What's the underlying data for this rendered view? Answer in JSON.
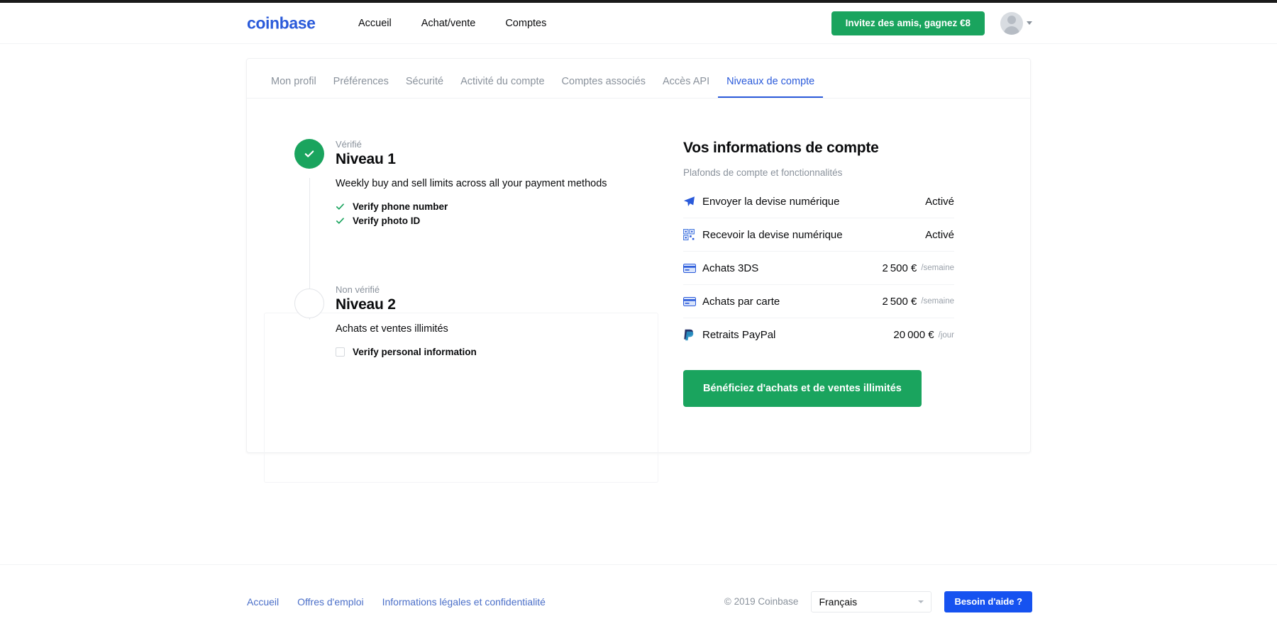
{
  "brand": {
    "logo_text": "coinbase",
    "primary_blue": "#2a5ada",
    "green": "#1aa45e",
    "help_blue": "#1652f0"
  },
  "header": {
    "nav": [
      {
        "label": "Accueil"
      },
      {
        "label": "Achat/vente"
      },
      {
        "label": "Comptes"
      }
    ],
    "invite_button": "Invitez des amis, gagnez €8",
    "avatar_icon": "user-avatar-icon",
    "caret_icon": "chevron-down-icon"
  },
  "tabs": [
    {
      "label": "Mon profil",
      "active": false
    },
    {
      "label": "Préférences",
      "active": false
    },
    {
      "label": "Sécurité",
      "active": false
    },
    {
      "label": "Activité du compte",
      "active": false
    },
    {
      "label": "Comptes associés",
      "active": false
    },
    {
      "label": "Accès API",
      "active": false
    },
    {
      "label": "Niveaux de compte",
      "active": true
    }
  ],
  "levels": [
    {
      "status": "Vérifié",
      "title": "Niveau 1",
      "description": "Weekly buy and sell limits across all your payment methods",
      "verified": true,
      "requirements": [
        {
          "label": "Verify phone number",
          "done": true
        },
        {
          "label": "Verify photo ID",
          "done": true
        }
      ]
    },
    {
      "status": "Non vérifié",
      "title": "Niveau 2",
      "description": "Achats et ventes illimités",
      "verified": false,
      "requirements": [
        {
          "label": "Verify personal information",
          "done": false
        }
      ]
    }
  ],
  "account_info": {
    "title": "Vos informations de compte",
    "subtitle": "Plafonds de compte et fonctionnalités",
    "rows": [
      {
        "icon": "send-plane-icon",
        "label": "Envoyer la devise numérique",
        "value": "Activé",
        "unit": ""
      },
      {
        "icon": "qr-code-icon",
        "label": "Recevoir la devise numérique",
        "value": "Activé",
        "unit": ""
      },
      {
        "icon": "credit-card-icon",
        "label": "Achats 3DS",
        "value": "2 500 €",
        "unit": "/semaine"
      },
      {
        "icon": "credit-card-icon",
        "label": "Achats par carte",
        "value": "2 500 €",
        "unit": "/semaine"
      },
      {
        "icon": "paypal-icon",
        "label": "Retraits PayPal",
        "value": "20 000 €",
        "unit": "/jour"
      }
    ],
    "cta_button": "Bénéficiez d'achats et de ventes illimités"
  },
  "footer": {
    "links": [
      {
        "label": "Accueil"
      },
      {
        "label": "Offres d'emploi"
      },
      {
        "label": "Informations légales et confidentialité"
      }
    ],
    "copyright": "© 2019 Coinbase",
    "language": "Français",
    "help_button": "Besoin d'aide ?"
  }
}
